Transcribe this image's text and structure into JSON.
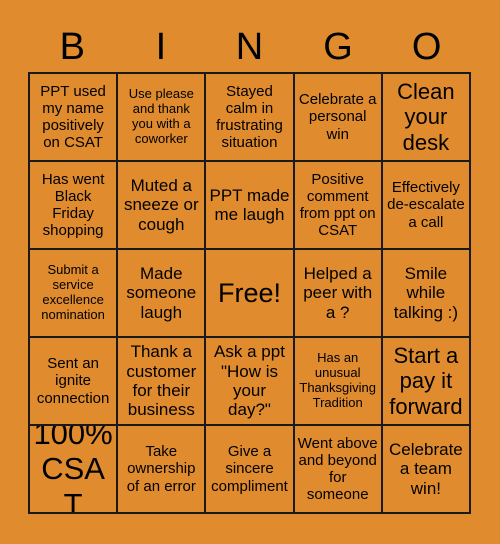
{
  "card": {
    "title_letters": [
      "B",
      "I",
      "N",
      "G",
      "O"
    ],
    "background_color": "#e08b2e",
    "border_color": "#1a1a1a",
    "text_color": "#000000",
    "rows": 5,
    "columns": 5,
    "cells": [
      {
        "text": "PPT used my name positively on CSAT",
        "size": "fs-sm",
        "free": false
      },
      {
        "text": "Use please and thank you with a coworker",
        "size": "fs-xs",
        "free": false
      },
      {
        "text": "Stayed calm in frustrating situation",
        "size": "fs-sm",
        "free": false
      },
      {
        "text": "Celebrate a personal win",
        "size": "fs-sm",
        "free": false
      },
      {
        "text": "Clean your desk",
        "size": "fs-lg",
        "free": false
      },
      {
        "text": "Has went Black Friday shopping",
        "size": "fs-sm",
        "free": false
      },
      {
        "text": "Muted a sneeze or cough",
        "size": "fs-md",
        "free": false
      },
      {
        "text": "PPT made me laugh",
        "size": "fs-md",
        "free": false
      },
      {
        "text": "Positive comment from ppt on CSAT",
        "size": "fs-sm",
        "free": false
      },
      {
        "text": "Effectively de-escalate a call",
        "size": "fs-sm",
        "free": false
      },
      {
        "text": "Submit a service excellence nomination",
        "size": "fs-xs",
        "free": false
      },
      {
        "text": "Made someone laugh",
        "size": "fs-md",
        "free": false
      },
      {
        "text": "Free!",
        "size": "fs-xl",
        "free": true
      },
      {
        "text": "Helped a peer with a ?",
        "size": "fs-md",
        "free": false
      },
      {
        "text": "Smile while talking :)",
        "size": "fs-md",
        "free": false
      },
      {
        "text": "Sent an ignite connection",
        "size": "fs-sm",
        "free": false
      },
      {
        "text": "Thank a customer for their business",
        "size": "fs-md",
        "free": false
      },
      {
        "text": "Ask a ppt \"How is your day?\"",
        "size": "fs-md",
        "free": false
      },
      {
        "text": "Has an unusual Thanksgiving Tradition",
        "size": "fs-xs",
        "free": false
      },
      {
        "text": "Start a pay it forward",
        "size": "fs-lg",
        "free": false
      },
      {
        "text": "100% CSAT",
        "size": "fs-xxl",
        "free": false
      },
      {
        "text": "Take ownership of an error",
        "size": "fs-sm",
        "free": false
      },
      {
        "text": "Give a sincere compliment",
        "size": "fs-sm",
        "free": false
      },
      {
        "text": "Went above and beyond for someone",
        "size": "fs-sm",
        "free": false
      },
      {
        "text": "Celebrate a team win!",
        "size": "fs-md",
        "free": false
      }
    ]
  }
}
